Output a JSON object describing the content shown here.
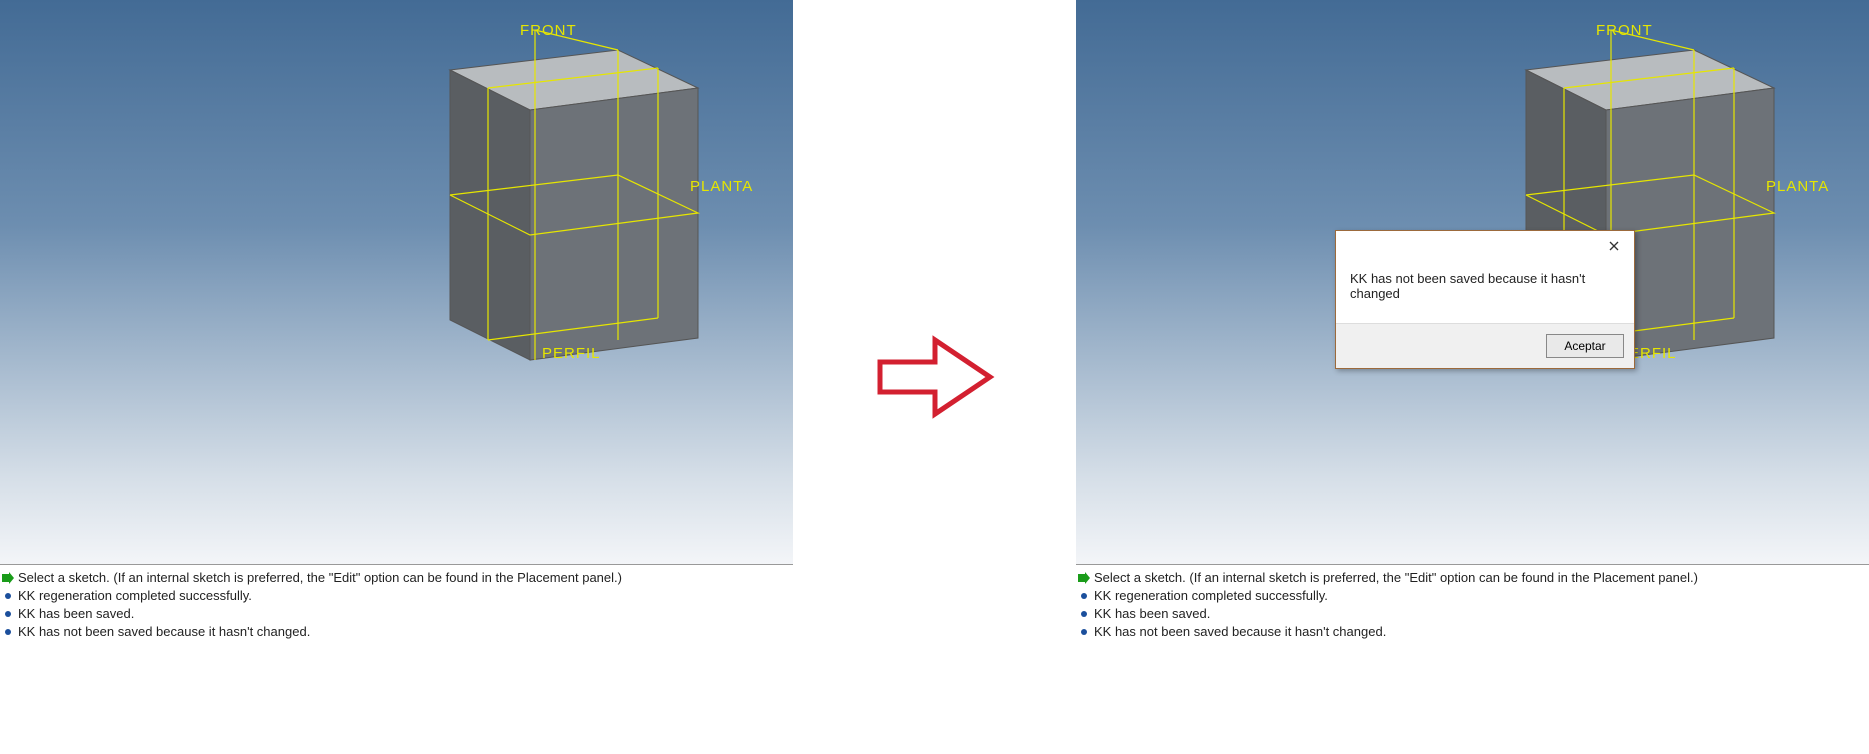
{
  "viewport": {
    "labels": {
      "front": "FRONT",
      "planta": "PLANTA",
      "perfil": "PERFIL"
    }
  },
  "status": {
    "line1": "Select a sketch. (If an internal sketch is preferred, the \"Edit\" option can be found in the Placement panel.)",
    "line2": "KK regeneration completed successfully.",
    "line3": "KK has been saved.",
    "line4": "KK has not been saved because it hasn't changed."
  },
  "dialog": {
    "message": "KK has not been saved because it hasn't changed",
    "accept_label": "Aceptar"
  }
}
